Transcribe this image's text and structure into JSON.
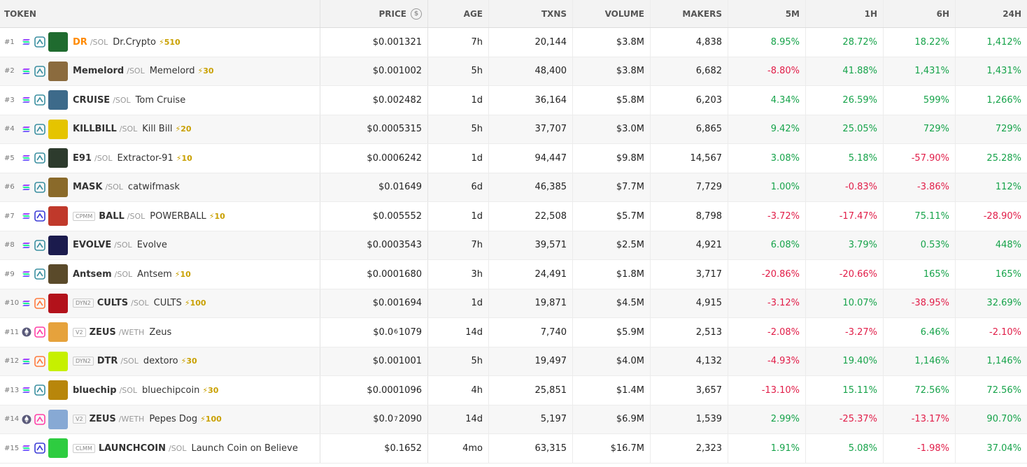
{
  "header": {
    "token": "TOKEN",
    "price": "PRICE",
    "age": "AGE",
    "txns": "TXNS",
    "volume": "VOLUME",
    "makers": "MAKERS",
    "m5": "5M",
    "h1": "1H",
    "h6": "6H",
    "h24": "24H",
    "price_icon": "$"
  },
  "rows": [
    {
      "rank": "#1",
      "pool": "",
      "symbol": "DR",
      "quote": "/SOL",
      "name": "Dr.Crypto",
      "boost": "⚡510",
      "price": "$0.001321",
      "age": "7h",
      "txns": "20,144",
      "volume": "$3.8M",
      "makers": "4,838",
      "m5": "8.95%",
      "h1": "28.72%",
      "h6": "18.22%",
      "h24": "1,412%",
      "avatar": "#1f6b2f"
    },
    {
      "rank": "#2",
      "pool": "",
      "symbol": "Memelord",
      "quote": "/SOL",
      "name": "Memelord",
      "boost": "⚡30",
      "price": "$0.001002",
      "age": "5h",
      "txns": "48,400",
      "volume": "$3.8M",
      "makers": "6,682",
      "m5": "-8.80%",
      "h1": "41.88%",
      "h6": "1,431%",
      "h24": "1,431%",
      "avatar": "#8b6b3e"
    },
    {
      "rank": "#3",
      "pool": "",
      "symbol": "CRUISE",
      "quote": "/SOL",
      "name": "Tom Cruise",
      "boost": "",
      "price": "$0.002482",
      "age": "1d",
      "txns": "36,164",
      "volume": "$5.8M",
      "makers": "6,203",
      "m5": "4.34%",
      "h1": "26.59%",
      "h6": "599%",
      "h24": "1,266%",
      "avatar": "#3d6a8a"
    },
    {
      "rank": "#4",
      "pool": "",
      "symbol": "KILLBILL",
      "quote": "/SOL",
      "name": "Kill Bill",
      "boost": "⚡20",
      "price": "$0.0005315",
      "age": "5h",
      "txns": "37,707",
      "volume": "$3.0M",
      "makers": "6,865",
      "m5": "9.42%",
      "h1": "25.05%",
      "h6": "729%",
      "h24": "729%",
      "avatar": "#e5c400"
    },
    {
      "rank": "#5",
      "pool": "",
      "symbol": "E91",
      "quote": "/SOL",
      "name": "Extractor-91",
      "boost": "⚡10",
      "price": "$0.0006242",
      "age": "1d",
      "txns": "94,447",
      "volume": "$9.8M",
      "makers": "14,567",
      "m5": "3.08%",
      "h1": "5.18%",
      "h6": "-57.90%",
      "h24": "25.28%",
      "avatar": "#2d3b2d"
    },
    {
      "rank": "#6",
      "pool": "",
      "symbol": "MASK",
      "quote": "/SOL",
      "name": "catwifmask",
      "boost": "",
      "price": "$0.01649",
      "age": "6d",
      "txns": "46,385",
      "volume": "$7.7M",
      "makers": "7,729",
      "m5": "1.00%",
      "h1": "-0.83%",
      "h6": "-3.86%",
      "h24": "112%",
      "avatar": "#8a6a2a"
    },
    {
      "rank": "#7",
      "pool": "CPMM",
      "symbol": "BALL",
      "quote": "/SOL",
      "name": "POWERBALL",
      "boost": "⚡10",
      "price": "$0.005552",
      "age": "1d",
      "txns": "22,508",
      "volume": "$5.7M",
      "makers": "8,798",
      "m5": "-3.72%",
      "h1": "-17.47%",
      "h6": "75.11%",
      "h24": "-28.90%",
      "avatar": "#c0392b"
    },
    {
      "rank": "#8",
      "pool": "",
      "symbol": "EVOLVE",
      "quote": "/SOL",
      "name": "Evolve",
      "boost": "",
      "price": "$0.0003543",
      "age": "7h",
      "txns": "39,571",
      "volume": "$2.5M",
      "makers": "4,921",
      "m5": "6.08%",
      "h1": "3.79%",
      "h6": "0.53%",
      "h24": "448%",
      "avatar": "#1b1b4d"
    },
    {
      "rank": "#9",
      "pool": "",
      "symbol": "Antsem",
      "quote": "/SOL",
      "name": "Antsem",
      "boost": "⚡10",
      "price": "$0.0001680",
      "age": "3h",
      "txns": "24,491",
      "volume": "$1.8M",
      "makers": "3,717",
      "m5": "-20.86%",
      "h1": "-20.66%",
      "h6": "165%",
      "h24": "165%",
      "avatar": "#5a4a2a"
    },
    {
      "rank": "#10",
      "pool": "DYN2",
      "symbol": "CULTS",
      "quote": "/SOL",
      "name": "CULTS",
      "boost": "⚡100",
      "price": "$0.001694",
      "age": "1d",
      "txns": "19,871",
      "volume": "$4.5M",
      "makers": "4,915",
      "m5": "-3.12%",
      "h1": "10.07%",
      "h6": "-38.95%",
      "h24": "32.69%",
      "avatar": "#b3121b"
    },
    {
      "rank": "#11",
      "pool": "V2",
      "symbol": "ZEUS",
      "quote": "/WETH",
      "name": "Zeus",
      "boost": "",
      "price_a": "$0.0",
      "price_sub": "6",
      "price_b": "1079",
      "age": "14d",
      "txns": "7,740",
      "volume": "$5.9M",
      "makers": "2,513",
      "m5": "-2.08%",
      "h1": "-3.27%",
      "h6": "6.46%",
      "h24": "-2.10%",
      "avatar": "#e6a23c"
    },
    {
      "rank": "#12",
      "pool": "DYN2",
      "symbol": "DTR",
      "quote": "/SOL",
      "name": "dextoro",
      "boost": "⚡30",
      "price": "$0.001001",
      "age": "5h",
      "txns": "19,497",
      "volume": "$4.0M",
      "makers": "4,132",
      "m5": "-4.93%",
      "h1": "19.40%",
      "h6": "1,146%",
      "h24": "1,146%",
      "avatar": "#c6f000"
    },
    {
      "rank": "#13",
      "pool": "",
      "symbol": "bluechip",
      "quote": "/SOL",
      "name": "bluechipcoin",
      "boost": "⚡30",
      "price": "$0.0001096",
      "age": "4h",
      "txns": "25,851",
      "volume": "$1.4M",
      "makers": "3,657",
      "m5": "-13.10%",
      "h1": "15.11%",
      "h6": "72.56%",
      "h24": "72.56%",
      "avatar": "#b8860b"
    },
    {
      "rank": "#14",
      "pool": "V2",
      "symbol": "ZEUS",
      "quote": "/WETH",
      "name": "Pepes Dog",
      "boost": "⚡100",
      "price_a": "$0.0",
      "price_sub": "7",
      "price_b": "2090",
      "age": "14d",
      "txns": "5,197",
      "volume": "$6.9M",
      "makers": "1,539",
      "m5": "2.99%",
      "h1": "-25.37%",
      "h6": "-13.17%",
      "h24": "90.70%",
      "avatar": "#87a9d4"
    },
    {
      "rank": "#15",
      "pool": "CLMM",
      "symbol": "LAUNCHCOIN",
      "quote": "/SOL",
      "name": "Launch Coin on Believe",
      "boost": "",
      "price": "$0.1652",
      "age": "4mo",
      "txns": "63,315",
      "volume": "$16.7M",
      "makers": "2,323",
      "m5": "1.91%",
      "h1": "5.08%",
      "h6": "-1.98%",
      "h24": "37.04%",
      "avatar": "#2ecc40"
    }
  ]
}
